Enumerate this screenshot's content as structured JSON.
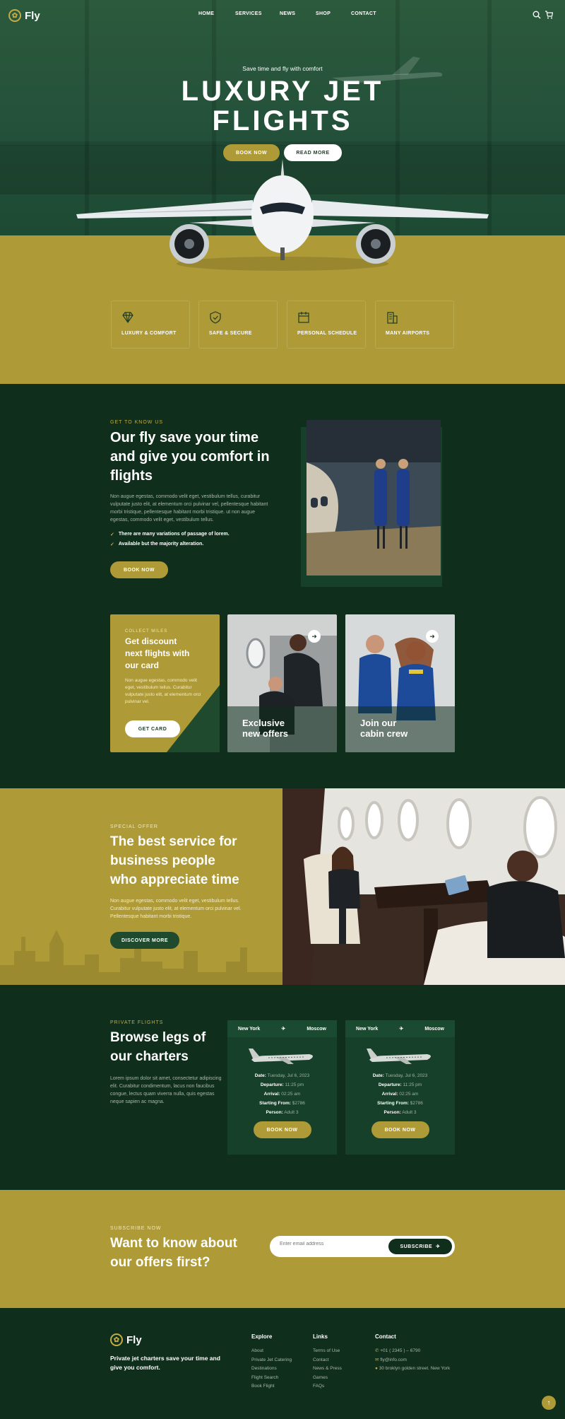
{
  "brand": {
    "name": "Fly"
  },
  "nav": {
    "items": [
      "HOME",
      "SERVICES",
      "NEWS",
      "SHOP",
      "CONTACT"
    ]
  },
  "hero": {
    "tagline": "Save time and fly with comfort",
    "title_line1": "LUXURY JET",
    "title_line2": "FLIGHTS",
    "book_now": "BOOK NOW",
    "read_more": "READ MORE"
  },
  "features": [
    {
      "label": "LUXURY & COMFORT",
      "icon": "diamond-icon"
    },
    {
      "label": "SAFE & SECURE",
      "icon": "shield-icon"
    },
    {
      "label": "PERSONAL SCHEDULE",
      "icon": "calendar-icon"
    },
    {
      "label": "MANY AIRPORTS",
      "icon": "building-icon"
    }
  ],
  "about": {
    "eyebrow": "GET TO KNOW US",
    "title_line1": "Our fly save your time",
    "title_line2": "and give you comfort in",
    "title_line3": "flights",
    "paragraph": "Non augue egestas, commodo velit eget, vestibulum tellus, curabitur vulputate justo elit, at elementum orci pulvinar vel, pellentesque habitant morbi tristique, pellentesque habitant morbi tristique. ut non augue egestas, commodo velit eget, vestibulum tellus.",
    "check1": "There are many variations of passage of lorem.",
    "check2": "Available but the majority alteration.",
    "button": "BOOK NOW"
  },
  "cards": {
    "miles": {
      "eyebrow": "COLLECT MILES",
      "title_line1": "Get discount",
      "title_line2": "next flights with",
      "title_line3": "our card",
      "paragraph": "Non augue egestas, commodo velit eget, vestibulum tellus. Curabitur vulputate justo elit, at elementum orci pulvinar vel.",
      "button": "GET CARD"
    },
    "offers": {
      "line1": "Exclusive",
      "line2": "new offers"
    },
    "crew": {
      "line1": "Join our",
      "line2": "cabin crew"
    }
  },
  "special": {
    "eyebrow": "SPECIAL OFFER",
    "title_line1": "The best service for",
    "title_line2": "business people",
    "title_line3": "who appreciate time",
    "paragraph": "Non augue egestas, commodo velit eget, vestibulum tellus. Curabitur vulputate justo elit, at elementum orci pulvinar vel. Pellentesque habitant morbi tristique.",
    "button": "DISCOVER MORE"
  },
  "private": {
    "eyebrow": "PRIVATE FLIGHTS",
    "title_line1": "Browse legs of",
    "title_line2": "our charters",
    "paragraph": "Lorem ipsum dolor sit amet, consectetur adipiscing elit. Curabitur condimentum, lacus non faucibus congue, lectus quam viverra nulla, quis egestas neque sapien ac magna.",
    "tickets": [
      {
        "from": "New York",
        "to": "Moscow",
        "date_label": "Date:",
        "date": "Tuesday, Jul 6, 2023",
        "departure_label": "Departure:",
        "departure": "11:25 pm",
        "arrival_label": "Arrival:",
        "arrival": "02:25 am",
        "price_label": "Starting From:",
        "price": "$2786",
        "person_label": "Person:",
        "person": "Adult 3",
        "button": "BOOK NOW"
      },
      {
        "from": "New York",
        "to": "Moscow",
        "date_label": "Date:",
        "date": "Tuesday, Jul 6, 2023",
        "departure_label": "Departure:",
        "departure": "11:25 pm",
        "arrival_label": "Arrival:",
        "arrival": "02:25 am",
        "price_label": "Starting From:",
        "price": "$2786",
        "person_label": "Person:",
        "person": "Adult 3",
        "button": "BOOK NOW"
      }
    ]
  },
  "subscribe": {
    "eyebrow": "SUBSCRIBE NOW",
    "title_line1": "Want to know about",
    "title_line2": "our offers first?",
    "placeholder": "Enter email address",
    "button": "SUBSCRIBE"
  },
  "footer": {
    "tagline_line1": "Private jet charters save your time and",
    "tagline_line2": "give you comfort.",
    "explore_title": "Explore",
    "explore": [
      "About",
      "Private Jet Catering",
      "Destinations",
      "Flight Search",
      "Book Flight"
    ],
    "links_title": "Links",
    "links": [
      "Terms of Use",
      "Contact",
      "News & Press",
      "Games",
      "FAQs"
    ],
    "contact_title": "Contact",
    "phone": "+01 ( 2345 ) – 6790",
    "email": "fly@info.com",
    "address": "30 broklyn golden street. New York"
  },
  "colors": {
    "gold": "#ae9a36",
    "dark_green": "#0f2e1c",
    "green": "#23503a"
  }
}
